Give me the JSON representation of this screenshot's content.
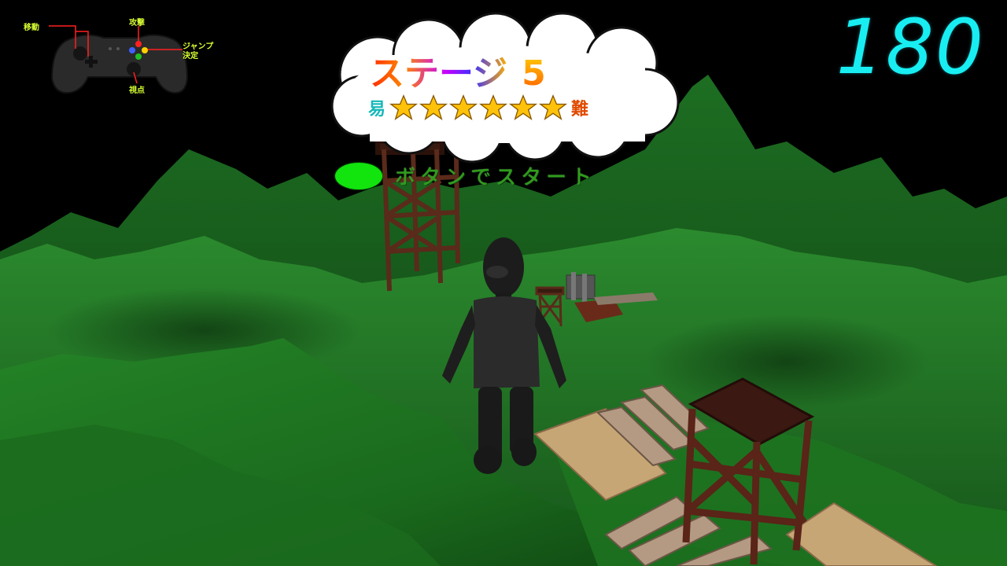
{
  "controller_help": {
    "move_label": "移動",
    "attack_label": "攻撃",
    "jump_label": "ジャンプ\n決定",
    "camera_label": "視点",
    "icon": "gamepad-icon"
  },
  "timer": {
    "value": "180"
  },
  "stage_card": {
    "title": "ステージ",
    "number": "5",
    "easy_label": "易",
    "hard_label": "難",
    "stars_filled": 6,
    "stars_total": 6,
    "star_icon": "star-icon"
  },
  "start_prompt": {
    "text": "ボタンでスタート",
    "button_icon": "green-button-icon",
    "button_color": "#12e40e"
  },
  "colors": {
    "timer": "#18eef2",
    "terrain": "#1f7a24",
    "sky": "#000000"
  }
}
